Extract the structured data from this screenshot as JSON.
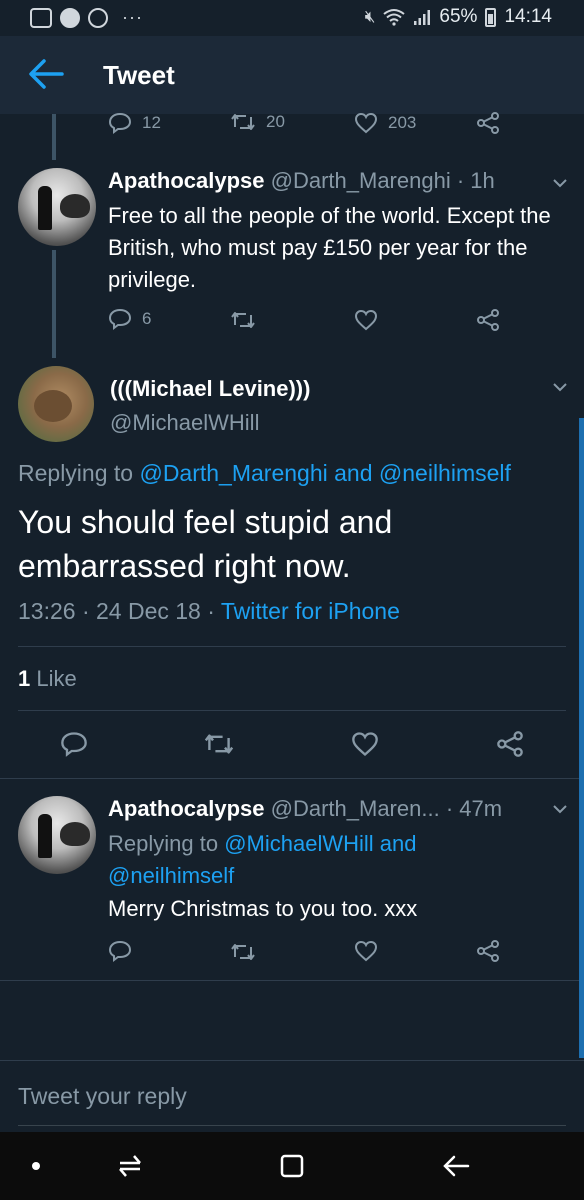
{
  "status_bar": {
    "battery": "65%",
    "time": "14:14",
    "dots": "···"
  },
  "header": {
    "title": "Tweet"
  },
  "parent_actions": {
    "reply_count": "12",
    "retweet_count": "20",
    "like_count": "203"
  },
  "reply1": {
    "name": "Apathocalypse",
    "handle": "@Darth_Marenghi",
    "time": "· 1h",
    "text": "Free to all the people of the world. Except the British, who must pay £150 per year for the privilege.",
    "reply_count": "6"
  },
  "main_tweet": {
    "name": "(((Michael Levine)))",
    "handle": "@MichaelWHill",
    "replying_prefix": "Replying to",
    "replying_user1": "@Darth_Marenghi",
    "replying_and": "and",
    "replying_user2": "@neilhimself",
    "text": "You should feel stupid and embarrassed right now.",
    "timestamp": "13:26 · 24 Dec 18 ·",
    "source": "Twitter for iPhone",
    "like_count": "1",
    "like_label": "Like"
  },
  "reply2": {
    "name": "Apathocalypse",
    "handle": "@Darth_Maren...",
    "time": "· 47m",
    "replying_prefix": "Replying to",
    "replying_user1": "@MichaelWHill",
    "replying_and": "and",
    "replying_user2": "@neilhimself",
    "text": "Merry Christmas to you too. xxx"
  },
  "reply_box": {
    "placeholder": "Tweet your reply"
  },
  "colors": {
    "background": "#15202b",
    "accent": "#1da1f2",
    "muted": "#8899a6"
  }
}
